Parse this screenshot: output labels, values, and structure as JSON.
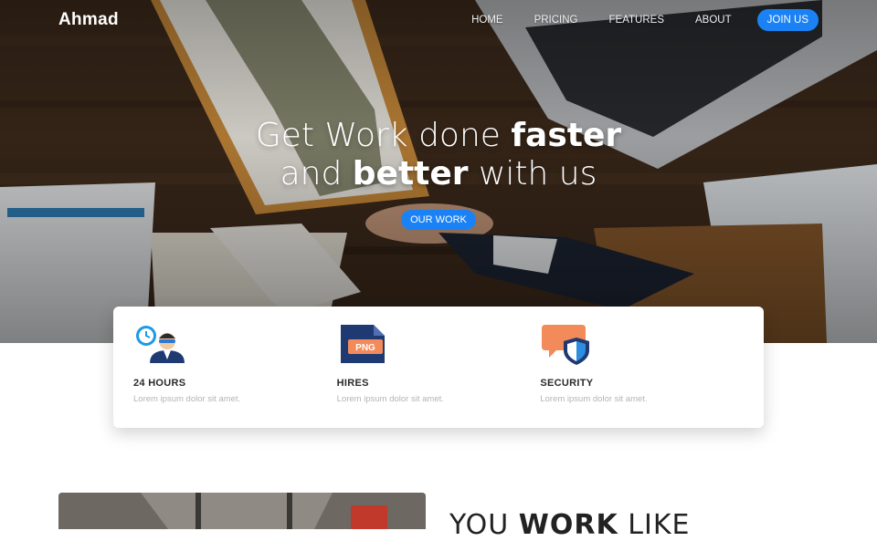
{
  "brand": "Ahmad",
  "nav": {
    "links": [
      "HOME",
      "PRICING",
      "FEATURES",
      "ABOUT"
    ],
    "cta": "JOIN US"
  },
  "hero": {
    "line1_light": "Get Work done ",
    "line1_bold": "faster",
    "line2_light1": "and ",
    "line2_bold": "better",
    "line2_light2": " with us",
    "cta": "OUR WORK"
  },
  "features": [
    {
      "title": "24 HOURS",
      "desc": "Lorem ipsum dolor sit amet.",
      "icon": "clock-person-icon"
    },
    {
      "title": "HIRES",
      "desc": "Lorem ipsum dolor sit amet.",
      "icon": "png-file-icon"
    },
    {
      "title": "SECURITY",
      "desc": "Lorem ipsum dolor sit amet.",
      "icon": "shield-chat-icon"
    }
  ],
  "section2": {
    "title_light1": "YOU ",
    "title_bold": "WORK",
    "title_light2": " LIKE"
  },
  "colors": {
    "accent": "#1a82f5",
    "text_dark": "#2a2a2a",
    "text_muted": "#b4b4b4"
  }
}
